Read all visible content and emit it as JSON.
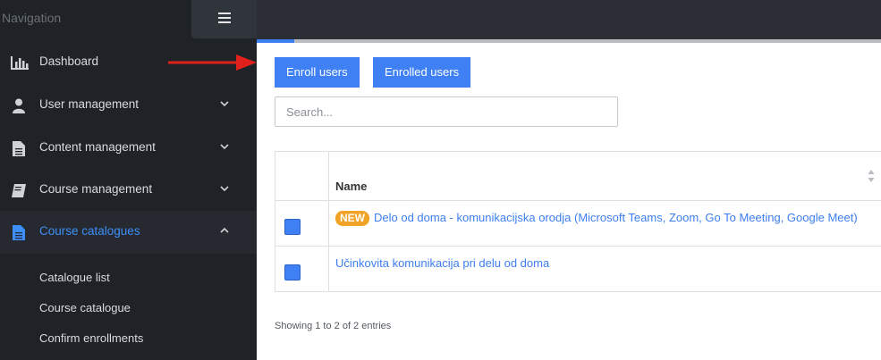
{
  "sidebar": {
    "title": "Navigation",
    "items": [
      {
        "label": "Dashboard",
        "icon": "bar-chart-icon"
      },
      {
        "label": "User management",
        "icon": "user-icon"
      },
      {
        "label": "Content management",
        "icon": "document-icon"
      },
      {
        "label": "Course management",
        "icon": "book-icon"
      },
      {
        "label": "Course catalogues",
        "icon": "file-icon"
      }
    ],
    "subitems": [
      "Catalogue list",
      "Course catalogue",
      "Confirm enrollments"
    ]
  },
  "toolbar": {
    "enroll_label": "Enroll users",
    "enrolled_label": "Enrolled users"
  },
  "search": {
    "placeholder": "Search...",
    "value": ""
  },
  "table": {
    "column_name": "Name",
    "rows": [
      {
        "badge": "NEW",
        "name": "Delo od doma - komunikacijska orodja (Microsoft Teams, Zoom, Go To Meeting, Google Meet)"
      },
      {
        "badge": "",
        "name": "Učinkovita komunikacija pri delu od doma"
      }
    ]
  },
  "footer": {
    "info": "Showing 1 to 2 of 2 entries"
  },
  "colors": {
    "accent": "#3f81f4",
    "badge": "#f0a326",
    "sidebar": "#1f2227",
    "arrow": "#e0201b"
  },
  "progress": {
    "fraction": 0.06
  }
}
